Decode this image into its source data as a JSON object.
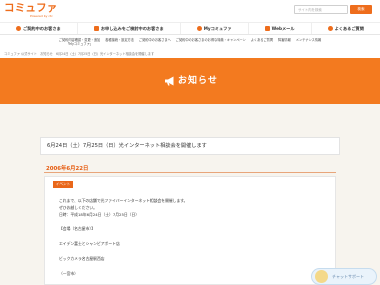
{
  "header": {
    "logo_text": "コミュファ",
    "logo_sub": "Powered by ctc",
    "search_placeholder": "サイト内を検索",
    "search_button": "検索"
  },
  "mainnav": {
    "items": [
      {
        "label": "ご契約中のお客さま",
        "icon": "person-icon"
      },
      {
        "label": "お申し込みをご検討中のお客さま",
        "icon": "document-icon"
      },
      {
        "label": "Myコミュファ",
        "icon": "user-circle-icon"
      },
      {
        "label": "Webメール",
        "icon": "mail-icon"
      },
      {
        "label": "よくあるご質問",
        "icon": "question-icon"
      }
    ]
  },
  "subnav": {
    "items": [
      {
        "line1": "ご契約内容確認・変更・追加",
        "line2": "「Myコミュファ」"
      },
      {
        "line1": "各種接続・設定方法",
        "line2": ""
      },
      {
        "line1": "ご契約中のお客さまへ",
        "line2": ""
      },
      {
        "line1": "ご契約中のお客さまのお得な特典・キャンペーン",
        "line2": ""
      },
      {
        "line1": "よくあるご質問",
        "line2": ""
      },
      {
        "line1": "障害情報",
        "line2": ""
      },
      {
        "line1": "メンテナンス情報",
        "line2": ""
      }
    ]
  },
  "breadcrumb": "コミュファ 公式サイト　お知らせ　6月24日（土）7月25日（日）光インターネット相談会を開催します",
  "banner": {
    "title": "お知らせ",
    "icon": "megaphone-icon",
    "color": "#f37a1f"
  },
  "article": {
    "title": "6月24日（土）7月25日（日）光インターネット相談会を開催します",
    "date": "2006年6月22日",
    "tag": "イベント",
    "lines": [
      "これまで、以下の店舗で光ファイバーインターネット相談会を開催します。",
      "ぜひお越しください。",
      "日時：平成18年6月24日（土）7月25日（日）",
      "",
      "【会場（名古屋市）】",
      "",
      "エイデン富士とシャンピアポート店",
      "",
      "ビックカメラ名古屋駅西店",
      "",
      "（一宮市）"
    ]
  },
  "chat": {
    "label": "チャットサポート",
    "icon": "chat-avatar-icon"
  }
}
